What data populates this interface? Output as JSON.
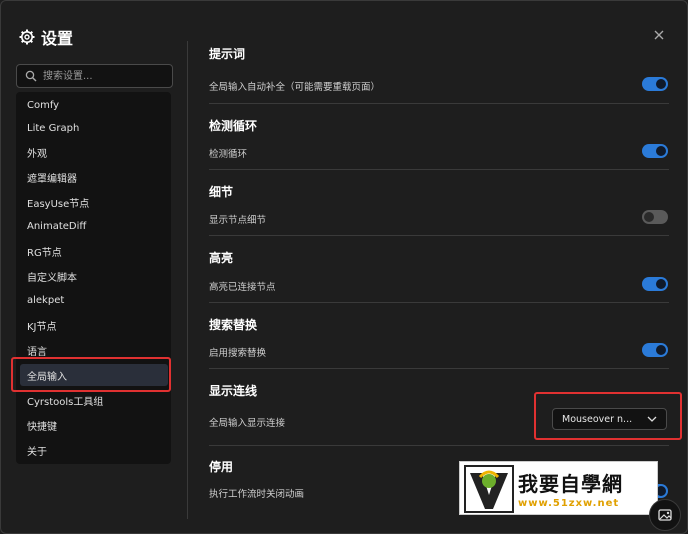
{
  "dialog": {
    "title": "设置",
    "close_label": "×"
  },
  "search": {
    "placeholder": "搜索设置..."
  },
  "sidebar": {
    "items": [
      {
        "label": "Comfy"
      },
      {
        "label": "Lite Graph"
      },
      {
        "label": "外观"
      },
      {
        "label": "遮罩编辑器"
      },
      {
        "label": "EasyUse节点"
      },
      {
        "label": "AnimateDiff"
      },
      {
        "label": "RG节点"
      },
      {
        "label": "自定义脚本"
      },
      {
        "label": "alekpet"
      },
      {
        "label": "KJ节点"
      },
      {
        "label": "语言"
      },
      {
        "label": "全局输入"
      },
      {
        "label": "Cyrstools工具组"
      },
      {
        "label": "快捷键"
      },
      {
        "label": "关于"
      }
    ],
    "selected": "全局输入"
  },
  "content": {
    "partial_header": "提示词",
    "sections": [
      {
        "title": "",
        "setting": "全局输入自动补全（可能需要重载页面）",
        "enabled": true
      },
      {
        "title": "检测循环",
        "setting": "检测循环",
        "enabled": true
      },
      {
        "title": "细节",
        "setting": "显示节点细节",
        "enabled": false
      },
      {
        "title": "高亮",
        "setting": "高亮已连接节点",
        "enabled": true
      },
      {
        "title": "搜索替换",
        "setting": "启用搜索替换",
        "enabled": true
      },
      {
        "title": "显示连线",
        "setting": "全局输入显示连接",
        "select_value": "Mouseover n..."
      },
      {
        "title": "停用",
        "setting": "执行工作流时关闭动画",
        "enabled": true
      }
    ]
  },
  "watermark": {
    "text": "我要自學網",
    "url": "www.51zxw.net"
  },
  "colors": {
    "accent": "#2b7bd9",
    "highlight": "#e03131",
    "background": "#1e1e1e"
  }
}
